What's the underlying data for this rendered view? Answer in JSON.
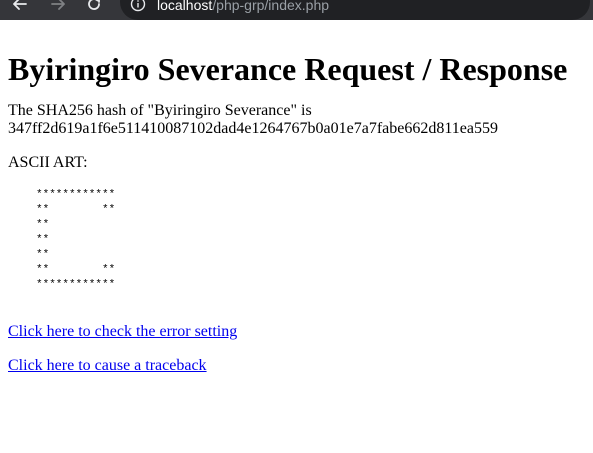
{
  "browser": {
    "url_host": "localhost",
    "url_path": "/php-grp/index.php"
  },
  "page": {
    "title": "Byiringiro Severance Request / Response",
    "hash_line1": "The SHA256 hash of \"Byiringiro Severance\" is",
    "hash_value": "347ff2d619a1f6e511410087102dad4e1264767b0a01e7a7fabe662d811ea559",
    "ascii_label": "ASCII ART:",
    "ascii_lines": [
      "************",
      "**        **",
      "**",
      "**",
      "**",
      "**        **",
      "************"
    ],
    "link_error_setting": "Click here to check the error setting",
    "link_traceback": "Click here to cause a traceback"
  },
  "colors": {
    "link": "#0000ee",
    "browser_bar": "#35363a"
  }
}
